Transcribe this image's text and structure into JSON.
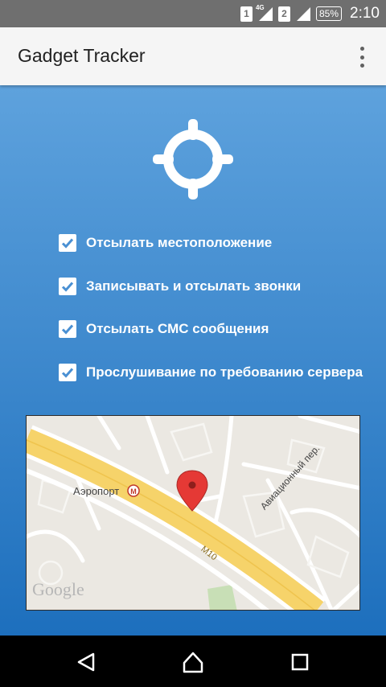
{
  "status_bar": {
    "sim1": "1",
    "sim2": "2",
    "network_type": "4G",
    "battery": "85%",
    "time": "2:10"
  },
  "app_bar": {
    "title": "Gadget Tracker",
    "overflow_icon": "more-vert-icon"
  },
  "main": {
    "header_icon": "crosshair-icon",
    "options": [
      {
        "label": "Отсылать местоположение",
        "checked": true
      },
      {
        "label": "Записывать и отсылать звонки",
        "checked": true
      },
      {
        "label": "Отсылать СМС сообщения",
        "checked": true
      },
      {
        "label": "Прослушивание по требованию сервера",
        "checked": true
      }
    ],
    "map": {
      "station_label": "Аэропорт",
      "street_label": "Авиационный пер.",
      "road_label": "М10",
      "brand": "Google",
      "pin_color": "#e53935"
    }
  },
  "colors": {
    "gradient_top": "#5ea2dd",
    "gradient_bottom": "#1d6fbd",
    "status_bar": "#6f6f6f",
    "app_bar": "#f5f5f5"
  },
  "nav_bar": {
    "back_icon": "back-triangle-icon",
    "home_icon": "home-icon",
    "recents_icon": "recents-square-icon"
  }
}
